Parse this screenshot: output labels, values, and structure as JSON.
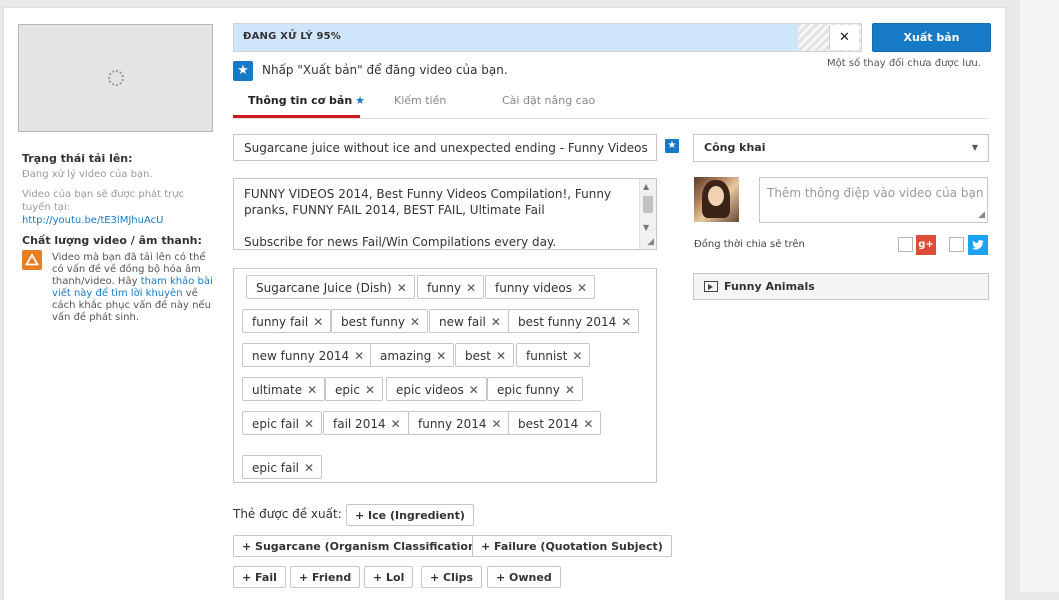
{
  "left": {
    "upload_status_label": "Trạng thái tải lên:",
    "upload_status_text": "Đang xử lý video của bạn.",
    "live_text": "Video của bạn sẽ được phát trực tuyến tại:",
    "video_url": "http://youtu.be/tE3lMJhuAcU",
    "quality_label": "Chất lượng video / âm thanh:",
    "quality_text_1": "Video mà bạn đã tải lên có thể có vấn đề về đồng bộ hóa âm thanh/video. Hãy",
    "quality_link": "tham khảo bài viết này để tìm lời khuyên",
    "quality_text_2": "về cách khắc phục vấn đề này nếu vấn đề phát sinh."
  },
  "progress": {
    "label": "ĐANG XỬ LÝ 95%",
    "percent": 95,
    "close_glyph": "✕"
  },
  "header": {
    "publish_label": "Xuất bản",
    "saved_note": "Một số thay đổi chưa được lưu.",
    "hint": "Nhấp \"Xuất bản\" để đăng video của bạn."
  },
  "tabs": [
    {
      "label": "Thông tin cơ bản",
      "active": true
    },
    {
      "label": "Kiếm tiền",
      "active": false
    },
    {
      "label": "Cài đặt nâng cao",
      "active": false
    }
  ],
  "form": {
    "title": "Sugarcane juice without ice and unexpected ending - Funny Videos",
    "description": "FUNNY VIDEOS 2014, Best Funny Videos Compilation!, Funny pranks, FUNNY FAIL 2014, BEST FAIL, Ultimate Fail\n\nSubscribe for news Fail/Win Compilations every day.",
    "tags": [
      "Sugarcane Juice (Dish)",
      "funny",
      "funny videos",
      "funny fail",
      "best funny",
      "new fail",
      "best funny 2014",
      "new funny 2014",
      "amazing",
      "best",
      "funnist",
      "ultimate",
      "epic",
      "epic videos",
      "epic funny",
      "epic fail",
      "fail 2014",
      "funny 2014",
      "best 2014",
      "epic fail"
    ],
    "suggested_label": "Thẻ được đề xuất:",
    "suggested": [
      "+ Ice (Ingredient)",
      "+ Sugarcane (Organism Classification)",
      "+ Failure (Quotation Subject)",
      "+ Fail",
      "+ Friend",
      "+ Lol",
      "+ Clips",
      "+ Owned"
    ]
  },
  "right": {
    "privacy": "Công khai",
    "message_placeholder": "Thêm thông điệp vào video của bạn",
    "share_label": "Đồng thời chia sẻ trên",
    "gplus_label": "g+",
    "playlist": "Funny Animals"
  }
}
